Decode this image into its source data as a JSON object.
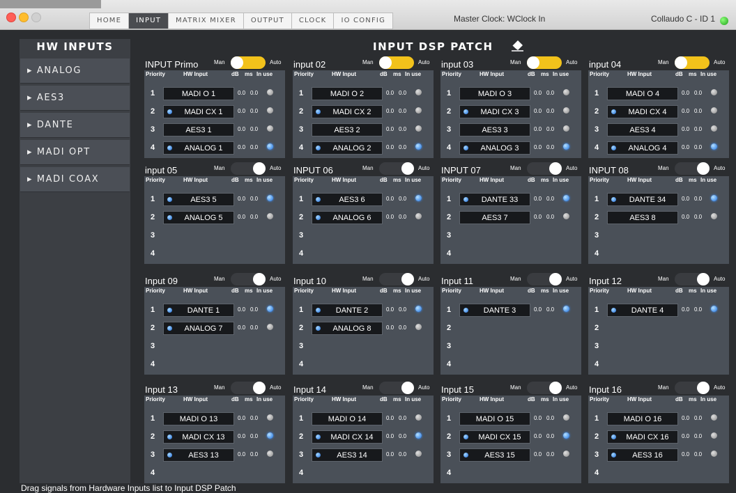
{
  "nav": {
    "tabs": [
      "HOME",
      "INPUT",
      "MATRIX MIXER",
      "OUTPUT",
      "CLOCK",
      "IO CONFIG"
    ],
    "active": "INPUT",
    "master_clock": "Master Clock: WClock In",
    "device": "Collaudo C - ID 1"
  },
  "sidebar": {
    "title": "HW INPUTS",
    "items": [
      "▸ ANALOG",
      "▸ AES3",
      "▸ DANTE",
      "▸ MADI OPT",
      "▸ MADI COAX"
    ]
  },
  "main": {
    "title": "INPUT DSP PATCH",
    "hint": "Drag signals from Hardware Inputs list to Input DSP Patch"
  },
  "labels": {
    "man": "Man",
    "auto": "Auto",
    "priority": "Priority",
    "hw_input": "HW Input",
    "db": "dB",
    "ms": "ms",
    "in_use": "In use"
  },
  "colors": {
    "toggle_on": "#f2c21b",
    "led_blue": "#1b6fe0",
    "panel_bg": "#4a5058"
  },
  "panels": [
    {
      "name": "INPUT Primo",
      "auto": true,
      "rows": [
        {
          "p": "1",
          "input": "MADI O 1",
          "led": false,
          "db": "0.0",
          "ms": "0.0",
          "in_use": false
        },
        {
          "p": "2",
          "input": "MADI CX 1",
          "led": true,
          "db": "0.0",
          "ms": "0.0",
          "in_use": false
        },
        {
          "p": "3",
          "input": "AES3 1",
          "led": false,
          "db": "0.0",
          "ms": "0.0",
          "in_use": false
        },
        {
          "p": "4",
          "input": "ANALOG 1",
          "led": true,
          "db": "0.0",
          "ms": "0.0",
          "in_use": true
        }
      ]
    },
    {
      "name": "input 02",
      "auto": true,
      "rows": [
        {
          "p": "1",
          "input": "MADI O 2",
          "led": false,
          "db": "0.0",
          "ms": "0.0",
          "in_use": false
        },
        {
          "p": "2",
          "input": "MADI CX 2",
          "led": true,
          "db": "0.0",
          "ms": "0.0",
          "in_use": false
        },
        {
          "p": "3",
          "input": "AES3 2",
          "led": false,
          "db": "0.0",
          "ms": "0.0",
          "in_use": false
        },
        {
          "p": "4",
          "input": "ANALOG 2",
          "led": true,
          "db": "0.0",
          "ms": "0.0",
          "in_use": true
        }
      ]
    },
    {
      "name": "input 03",
      "auto": true,
      "rows": [
        {
          "p": "1",
          "input": "MADI O 3",
          "led": false,
          "db": "0.0",
          "ms": "0.0",
          "in_use": false
        },
        {
          "p": "2",
          "input": "MADI CX 3",
          "led": true,
          "db": "0.0",
          "ms": "0.0",
          "in_use": false
        },
        {
          "p": "3",
          "input": "AES3 3",
          "led": false,
          "db": "0.0",
          "ms": "0.0",
          "in_use": false
        },
        {
          "p": "4",
          "input": "ANALOG 3",
          "led": true,
          "db": "0.0",
          "ms": "0.0",
          "in_use": true
        }
      ]
    },
    {
      "name": "input 04",
      "auto": true,
      "rows": [
        {
          "p": "1",
          "input": "MADI O 4",
          "led": false,
          "db": "0.0",
          "ms": "0.0",
          "in_use": false
        },
        {
          "p": "2",
          "input": "MADI CX 4",
          "led": true,
          "db": "0.0",
          "ms": "0.0",
          "in_use": false
        },
        {
          "p": "3",
          "input": "AES3 4",
          "led": false,
          "db": "0.0",
          "ms": "0.0",
          "in_use": false
        },
        {
          "p": "4",
          "input": "ANALOG 4",
          "led": true,
          "db": "0.0",
          "ms": "0.0",
          "in_use": true
        }
      ]
    },
    {
      "name": "input 05",
      "auto": false,
      "rows": [
        {
          "p": "1",
          "input": "AES3 5",
          "led": true,
          "db": "0.0",
          "ms": "0.0",
          "in_use": true
        },
        {
          "p": "2",
          "input": "ANALOG 5",
          "led": true,
          "db": "0.0",
          "ms": "0.0",
          "in_use": false
        },
        {
          "p": "3"
        },
        {
          "p": "4"
        }
      ]
    },
    {
      "name": "INPUT 06",
      "auto": false,
      "rows": [
        {
          "p": "1",
          "input": "AES3 6",
          "led": true,
          "db": "0.0",
          "ms": "0.0",
          "in_use": true
        },
        {
          "p": "2",
          "input": "ANALOG 6",
          "led": true,
          "db": "0.0",
          "ms": "0.0",
          "in_use": false
        },
        {
          "p": "3"
        },
        {
          "p": "4"
        }
      ]
    },
    {
      "name": "INPUT 07",
      "auto": false,
      "rows": [
        {
          "p": "1",
          "input": "DANTE 33",
          "led": true,
          "db": "0.0",
          "ms": "0.0",
          "in_use": true
        },
        {
          "p": "2",
          "input": "AES3 7",
          "led": false,
          "db": "0.0",
          "ms": "0.0",
          "in_use": false
        },
        {
          "p": "3"
        },
        {
          "p": "4"
        }
      ]
    },
    {
      "name": "INPUT 08",
      "auto": false,
      "rows": [
        {
          "p": "1",
          "input": "DANTE 34",
          "led": true,
          "db": "0.0",
          "ms": "0.0",
          "in_use": true
        },
        {
          "p": "2",
          "input": "AES3 8",
          "led": false,
          "db": "0.0",
          "ms": "0.0",
          "in_use": false
        },
        {
          "p": "3"
        },
        {
          "p": "4"
        }
      ]
    },
    {
      "name": "Input 09",
      "auto": false,
      "rows": [
        {
          "p": "1",
          "input": "DANTE 1",
          "led": true,
          "db": "0.0",
          "ms": "0.0",
          "in_use": true
        },
        {
          "p": "2",
          "input": "ANALOG 7",
          "led": true,
          "db": "0.0",
          "ms": "0.0",
          "in_use": false
        },
        {
          "p": "3"
        },
        {
          "p": "4"
        }
      ]
    },
    {
      "name": "Input 10",
      "auto": false,
      "rows": [
        {
          "p": "1",
          "input": "DANTE 2",
          "led": true,
          "db": "0.0",
          "ms": "0.0",
          "in_use": true
        },
        {
          "p": "2",
          "input": "ANALOG 8",
          "led": true,
          "db": "0.0",
          "ms": "0.0",
          "in_use": false
        },
        {
          "p": "3"
        },
        {
          "p": "4"
        }
      ]
    },
    {
      "name": "Input 11",
      "auto": false,
      "rows": [
        {
          "p": "1",
          "input": "DANTE 3",
          "led": true,
          "db": "0.0",
          "ms": "0.0",
          "in_use": true
        },
        {
          "p": "2"
        },
        {
          "p": "3"
        },
        {
          "p": "4"
        }
      ]
    },
    {
      "name": "Input 12",
      "auto": false,
      "rows": [
        {
          "p": "1",
          "input": "DANTE 4",
          "led": true,
          "db": "0.0",
          "ms": "0.0",
          "in_use": true
        },
        {
          "p": "2"
        },
        {
          "p": "3"
        },
        {
          "p": "4"
        }
      ]
    },
    {
      "name": "Input 13",
      "auto": false,
      "rows": [
        {
          "p": "1",
          "input": "MADI O 13",
          "led": false,
          "db": "0.0",
          "ms": "0.0",
          "in_use": false
        },
        {
          "p": "2",
          "input": "MADI CX 13",
          "led": true,
          "db": "0.0",
          "ms": "0.0",
          "in_use": true
        },
        {
          "p": "3",
          "input": "AES3 13",
          "led": true,
          "db": "0.0",
          "ms": "0.0",
          "in_use": false
        },
        {
          "p": "4"
        }
      ]
    },
    {
      "name": "Input 14",
      "auto": false,
      "rows": [
        {
          "p": "1",
          "input": "MADI O 14",
          "led": false,
          "db": "0.0",
          "ms": "0.0",
          "in_use": false
        },
        {
          "p": "2",
          "input": "MADI CX 14",
          "led": true,
          "db": "0.0",
          "ms": "0.0",
          "in_use": true
        },
        {
          "p": "3",
          "input": "AES3 14",
          "led": true,
          "db": "0.0",
          "ms": "0.0",
          "in_use": false
        },
        {
          "p": "4"
        }
      ]
    },
    {
      "name": "Input 15",
      "auto": false,
      "rows": [
        {
          "p": "1",
          "input": "MADI O 15",
          "led": false,
          "db": "0.0",
          "ms": "0.0",
          "in_use": false
        },
        {
          "p": "2",
          "input": "MADI CX 15",
          "led": true,
          "db": "0.0",
          "ms": "0.0",
          "in_use": true
        },
        {
          "p": "3",
          "input": "AES3 15",
          "led": true,
          "db": "0.0",
          "ms": "0.0",
          "in_use": false
        },
        {
          "p": "4"
        }
      ]
    },
    {
      "name": "Input 16",
      "auto": false,
      "rows": [
        {
          "p": "1",
          "input": "MADI O 16",
          "led": false,
          "db": "0.0",
          "ms": "0.0",
          "in_use": false
        },
        {
          "p": "2",
          "input": "MADI CX 16",
          "led": true,
          "db": "0.0",
          "ms": "0.0",
          "in_use": false
        },
        {
          "p": "3",
          "input": "AES3 16",
          "led": true,
          "db": "0.0",
          "ms": "0.0",
          "in_use": false
        },
        {
          "p": "4"
        }
      ]
    }
  ]
}
